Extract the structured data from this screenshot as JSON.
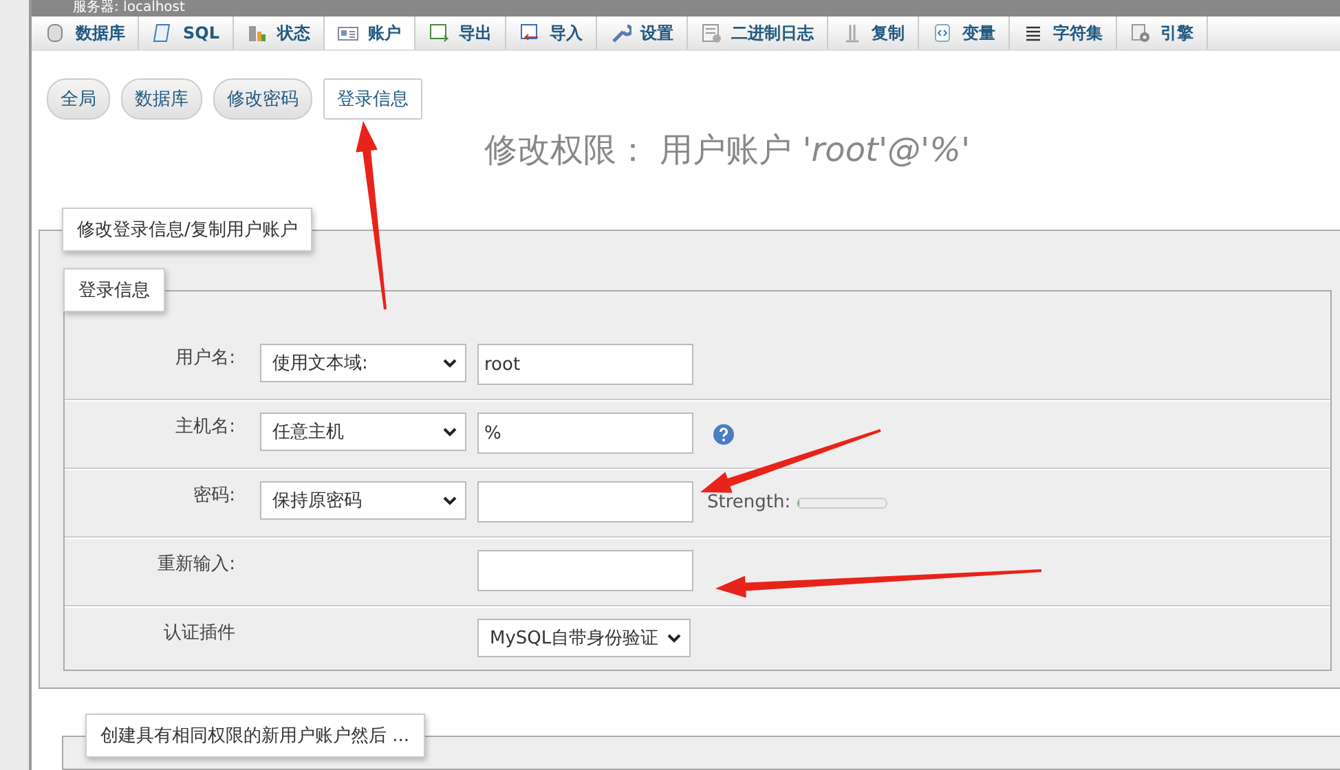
{
  "window": {
    "title": "服务器: localhost"
  },
  "tabs": [
    {
      "label": "数据库",
      "selected": false
    },
    {
      "label": "SQL",
      "selected": false
    },
    {
      "label": "状态",
      "selected": false
    },
    {
      "label": "账户",
      "selected": true
    },
    {
      "label": "导出",
      "selected": false
    },
    {
      "label": "导入",
      "selected": false
    },
    {
      "label": "设置",
      "selected": false
    },
    {
      "label": "二进制日志",
      "selected": false
    },
    {
      "label": "复制",
      "selected": false
    },
    {
      "label": "变量",
      "selected": false
    },
    {
      "label": "字符集",
      "selected": false
    },
    {
      "label": "引擎",
      "selected": false
    }
  ],
  "subtabs": [
    {
      "label": "全局",
      "selected": false
    },
    {
      "label": "数据库",
      "selected": false
    },
    {
      "label": "修改密码",
      "selected": false
    },
    {
      "label": "登录信息",
      "selected": true
    }
  ],
  "page_title": "修改权限：  用户账户  *'root'@'%'*",
  "login_fieldset": {
    "legend": "修改登录信息/复制用户账户",
    "inner_legend": "登录信息",
    "rows": [
      {
        "kind": "select_input",
        "label": "用户名:",
        "select": "使用文本域:",
        "value": "root",
        "help": false
      },
      {
        "kind": "select_input",
        "label": "主机名:",
        "select": "任意主机",
        "value": "%",
        "help": true
      },
      {
        "kind": "select_password",
        "label": "密码:",
        "select": "保持原密码",
        "strength_label": "Strength:",
        "level": 0
      },
      {
        "kind": "input",
        "label": "重新输入:"
      },
      {
        "kind": "select",
        "label": "认证插件",
        "select": "MySQL自带身份验证"
      }
    ]
  },
  "next_fieldset": {
    "legend": "创建具有相同权限的新用户账户然后 ..."
  }
}
